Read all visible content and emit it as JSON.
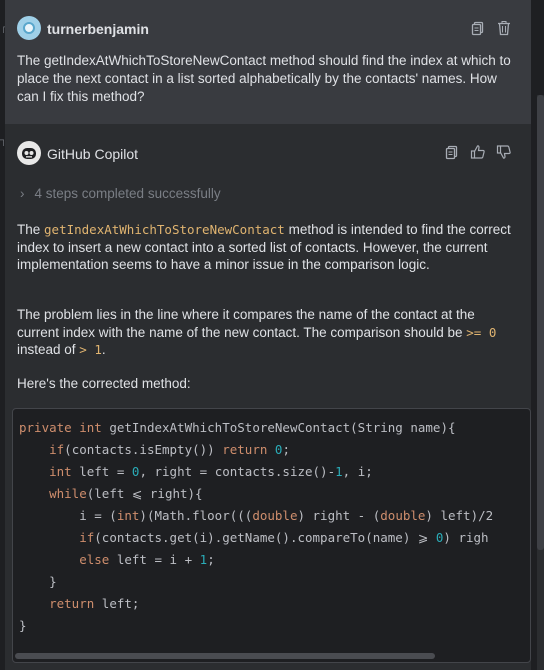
{
  "user": {
    "name": "turnerbenjamin",
    "message": "The getIndexAtWhichToStoreNewContact method should find the index at which to place the next contact in a list sorted alphabetically by the contacts' names. How can I fix this method?"
  },
  "copilot": {
    "name": "GitHub Copilot",
    "steps": "4 steps completed successfully",
    "para1": {
      "pre": "The ",
      "code": "getIndexAtWhichToStoreNewContact",
      "post": " method is intended to find the correct index to insert a new contact into a sorted list of contacts. However, the current implementation seems to have a minor issue in the comparison logic."
    },
    "para2": {
      "pre": "The problem lies in the line where it compares the name of the contact at the current index with the name of the new contact. The comparison should be ",
      "code1": ">= 0",
      "mid": " instead of ",
      "code2": "> 1",
      "post": "."
    },
    "para3": "Here's the corrected method:"
  },
  "code": {
    "lines": [
      [
        [
          "kw",
          "private "
        ],
        [
          "kw",
          "int "
        ],
        [
          "t",
          "getIndexAtWhichToStoreNewContact(String name){"
        ]
      ],
      [
        [
          "t",
          "    "
        ],
        [
          "kw",
          "if"
        ],
        [
          "t",
          "(contacts.isEmpty()) "
        ],
        [
          "kw",
          "return "
        ],
        [
          "num",
          "0"
        ],
        [
          "t",
          ";"
        ]
      ],
      [
        [
          "t",
          "    "
        ],
        [
          "kw",
          "int "
        ],
        [
          "t",
          "left = "
        ],
        [
          "num",
          "0"
        ],
        [
          "t",
          ", right = contacts.size()-"
        ],
        [
          "num",
          "1"
        ],
        [
          "t",
          ", i;"
        ]
      ],
      [
        [
          "t",
          "    "
        ],
        [
          "kw",
          "while"
        ],
        [
          "t",
          "(left ⩽ right){"
        ]
      ],
      [
        [
          "t",
          "        i = ("
        ],
        [
          "kw",
          "int"
        ],
        [
          "t",
          ")(Math.floor((("
        ],
        [
          "kw",
          "double"
        ],
        [
          "t",
          ") right - ("
        ],
        [
          "kw",
          "double"
        ],
        [
          "t",
          ") left)/2"
        ]
      ],
      [
        [
          "t",
          "        "
        ],
        [
          "kw",
          "if"
        ],
        [
          "t",
          "(contacts.get(i).getName().compareTo(name) ⩾ "
        ],
        [
          "num",
          "0"
        ],
        [
          "t",
          ") righ"
        ]
      ],
      [
        [
          "t",
          "        "
        ],
        [
          "kw",
          "else "
        ],
        [
          "t",
          "left = i + "
        ],
        [
          "num",
          "1"
        ],
        [
          "t",
          ";"
        ]
      ],
      [
        [
          "t",
          "    }"
        ]
      ],
      [
        [
          "t",
          "    "
        ],
        [
          "kw",
          "return "
        ],
        [
          "t",
          "left;"
        ]
      ],
      [
        [
          "t",
          "}"
        ]
      ]
    ]
  },
  "colors": {
    "keyword": "#cf8e6d",
    "number": "#2aacb8",
    "inline_code": "#e0b470"
  },
  "icons": [
    "copy-icon",
    "trash-icon",
    "thumbs-up-icon",
    "thumbs-down-icon",
    "chevron-right-icon"
  ]
}
